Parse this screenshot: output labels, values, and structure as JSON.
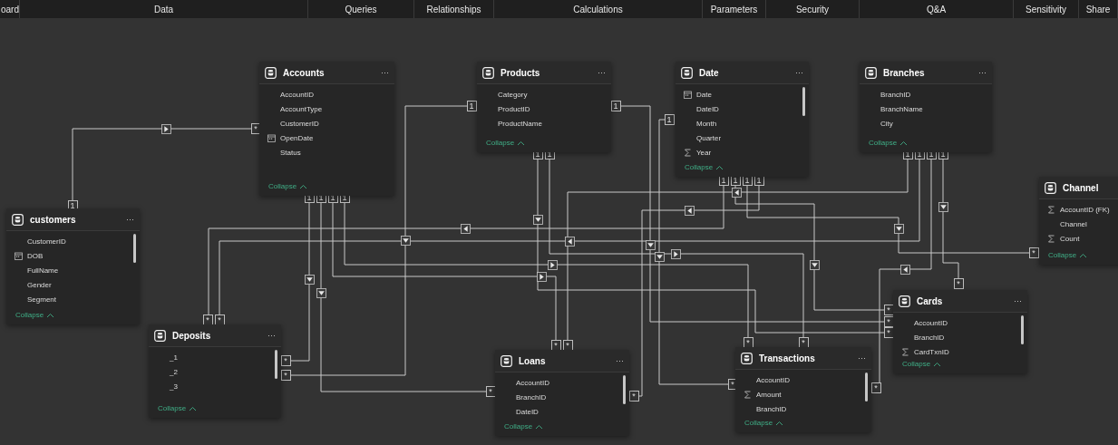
{
  "ribbon": {
    "tabs": [
      {
        "label": "oard"
      },
      {
        "label": "Data"
      },
      {
        "label": "Queries"
      },
      {
        "label": "Relationships"
      },
      {
        "label": "Calculations"
      },
      {
        "label": "Parameters"
      },
      {
        "label": "Security"
      },
      {
        "label": "Q&A"
      },
      {
        "label": "Sensitivity"
      },
      {
        "label": "Share"
      }
    ]
  },
  "tables": [
    {
      "name": "Accounts",
      "menu": "···",
      "scrollable": false,
      "collapse": "Collapse",
      "fields": [
        {
          "name": "AccountID",
          "kind": "column"
        },
        {
          "name": "AccountType",
          "kind": "column"
        },
        {
          "name": "CustomerID",
          "kind": "column"
        },
        {
          "name": "OpenDate",
          "kind": "date"
        },
        {
          "name": "Status",
          "kind": "column"
        }
      ]
    },
    {
      "name": "Products",
      "menu": "···",
      "scrollable": false,
      "collapse": "Collapse",
      "fields": [
        {
          "name": "Category",
          "kind": "column"
        },
        {
          "name": "ProductID",
          "kind": "column"
        },
        {
          "name": "ProductName",
          "kind": "column"
        }
      ]
    },
    {
      "name": "Date",
      "menu": "···",
      "scrollable": true,
      "collapse": "Collapse",
      "fields": [
        {
          "name": "Date",
          "kind": "date"
        },
        {
          "name": "DateID",
          "kind": "column"
        },
        {
          "name": "Month",
          "kind": "column"
        },
        {
          "name": "Quarter",
          "kind": "column"
        },
        {
          "name": "Year",
          "kind": "measure"
        }
      ]
    },
    {
      "name": "Branches",
      "menu": "···",
      "scrollable": false,
      "collapse": "Collapse",
      "fields": [
        {
          "name": "BranchID",
          "kind": "column"
        },
        {
          "name": "BranchName",
          "kind": "column"
        },
        {
          "name": "City",
          "kind": "column"
        }
      ]
    },
    {
      "name": "customers",
      "menu": "···",
      "scrollable": true,
      "collapse": "Collapse",
      "fields": [
        {
          "name": "CustomerID",
          "kind": "column"
        },
        {
          "name": "DOB",
          "kind": "date"
        },
        {
          "name": "FullName",
          "kind": "column"
        },
        {
          "name": "Gender",
          "kind": "column"
        },
        {
          "name": "Segment",
          "kind": "column"
        }
      ]
    },
    {
      "name": "Channel",
      "scrollable": false,
      "collapse": "Collapse",
      "fields": [
        {
          "name": "AccountID (FK)",
          "kind": "measure"
        },
        {
          "name": "Channel",
          "kind": "column"
        },
        {
          "name": "Count",
          "kind": "measure"
        }
      ]
    },
    {
      "name": "Cards",
      "menu": "···",
      "scrollable": true,
      "collapse": "Collapse",
      "fields": [
        {
          "name": "AccountID",
          "kind": "column"
        },
        {
          "name": "BranchID",
          "kind": "column"
        },
        {
          "name": "CardTxnID",
          "kind": "measure"
        }
      ]
    },
    {
      "name": "Deposits",
      "menu": "···",
      "scrollable": true,
      "collapse": "Collapse",
      "fields": [
        {
          "name": "_1",
          "kind": "column"
        },
        {
          "name": "_2",
          "kind": "column"
        },
        {
          "name": "_3",
          "kind": "column"
        }
      ]
    },
    {
      "name": "Loans",
      "menu": "···",
      "scrollable": true,
      "collapse": "Collapse",
      "fields": [
        {
          "name": "AccountID",
          "kind": "column"
        },
        {
          "name": "BranchID",
          "kind": "column"
        },
        {
          "name": "DateID",
          "kind": "column"
        }
      ]
    },
    {
      "name": "Transactions",
      "menu": "···",
      "scrollable": true,
      "collapse": "Collapse",
      "fields": [
        {
          "name": "AccountID",
          "kind": "column"
        },
        {
          "name": "Amount",
          "kind": "measure"
        },
        {
          "name": "BranchID",
          "kind": "column"
        }
      ]
    }
  ],
  "relationships": [
    {
      "one": "1",
      "many": "*"
    },
    {
      "one": "1",
      "many": "*"
    },
    {
      "one": "1",
      "many": "*"
    },
    {
      "one": "1",
      "many": "*"
    },
    {
      "one": "1",
      "many": "*"
    },
    {
      "one": "1",
      "many": "*"
    },
    {
      "one": "1",
      "many": "*"
    },
    {
      "one": "1",
      "many": "*"
    },
    {
      "one": "1",
      "many": "*"
    },
    {
      "one": "1",
      "many": "*"
    },
    {
      "one": "1",
      "many": "*"
    },
    {
      "one": "1",
      "many": "*"
    },
    {
      "one": "1",
      "many": "*"
    },
    {
      "one": "1",
      "many": "*"
    },
    {
      "one": "1",
      "many": "*"
    },
    {
      "one": "1",
      "many": "*"
    },
    {
      "one": "1",
      "many": "*"
    },
    {
      "one": "1",
      "many": "*"
    }
  ]
}
